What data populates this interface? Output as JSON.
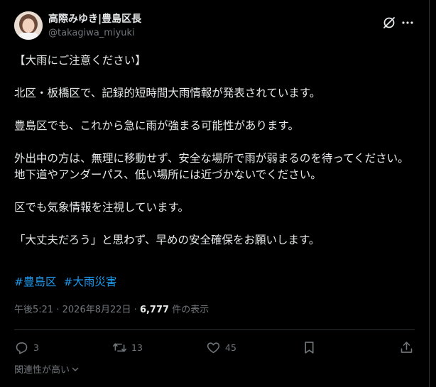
{
  "post": {
    "author": {
      "display_name": "高際みゆき|豊島区長",
      "handle": "@takagiwa_miyuki"
    },
    "body": [
      "【大雨にご注意ください】",
      "北区・板橋区で、記録的短時間大雨情報が発表されています。",
      "豊島区でも、これから急に雨が強まる可能性があります。",
      "外出中の方は、無理に移動せず、安全な場所で雨が弱まるのを待ってください。地下道やアンダーパス、低い場所には近づかないでください。",
      "区でも気象情報を注視しています。",
      "「大丈夫だろう」と思わず、早めの安全確保をお願いします。"
    ],
    "hashtags": [
      "#豊島区",
      "#大雨災害"
    ],
    "meta": {
      "time": "午後5:21",
      "separator": "·",
      "date": "2026年8月22日",
      "views_count": "6,777",
      "views_label": "件の表示"
    },
    "actions": {
      "reply_count": "3",
      "repost_count": "13",
      "like_count": "45"
    },
    "sort_label": "関連性が高い"
  },
  "icons": {
    "grok": "grok-icon",
    "more": "more-icon",
    "reply": "reply-icon",
    "repost": "repost-icon",
    "like": "heart-icon",
    "bookmark": "bookmark-icon",
    "share": "share-icon",
    "chevron": "chevron-down-icon"
  },
  "colors": {
    "background": "#000000",
    "text": "#e7e9ea",
    "muted": "#71767b",
    "link": "#1d9bf0",
    "divider": "#2f3336"
  }
}
